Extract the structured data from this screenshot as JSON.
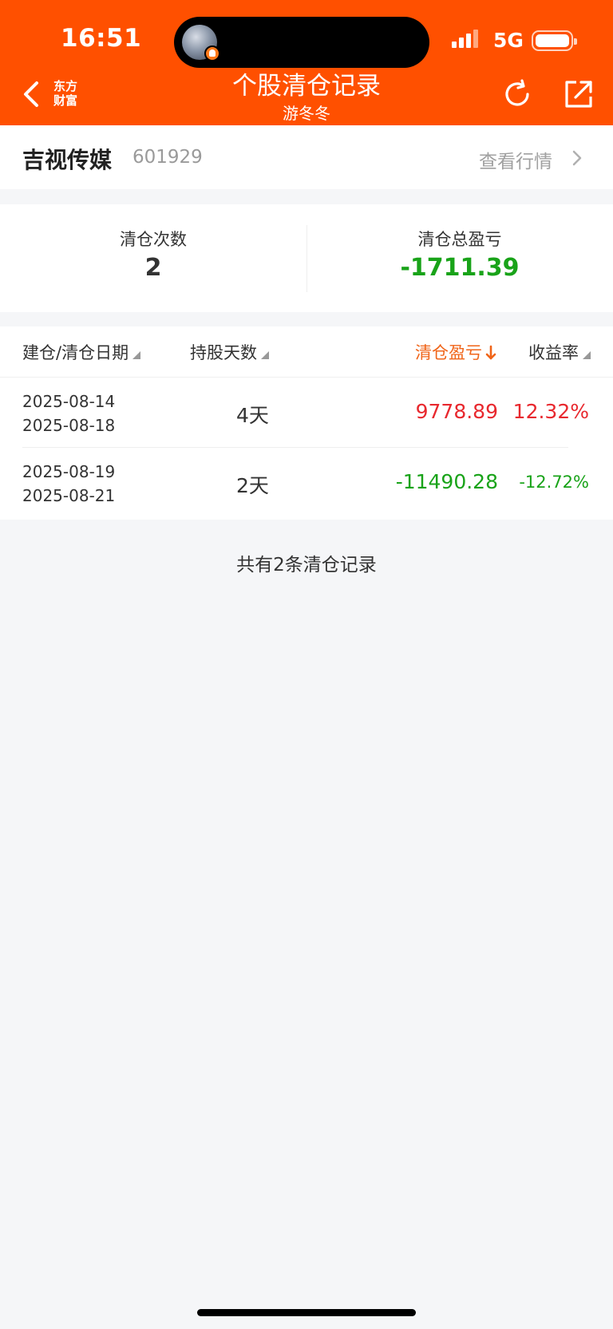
{
  "status_bar": {
    "time": "16:51",
    "network": "5G"
  },
  "header": {
    "brand_line1": "东方",
    "brand_line2": "财富",
    "title": "个股清仓记录",
    "subtitle": "游冬冬",
    "background": "#ff5000"
  },
  "stock": {
    "name": "吉视传媒",
    "code": "601929",
    "view_quote": "查看行情"
  },
  "summary": {
    "count_label": "清仓次数",
    "count_value": "2",
    "total_label": "清仓总盈亏",
    "total_value": "-1711.39"
  },
  "table": {
    "headers": {
      "date": "建仓/清仓日期",
      "hold_days": "持股天数",
      "pnl": "清仓盈亏",
      "return_rate": "收益率"
    },
    "rows": [
      {
        "open_date": "2025-08-14",
        "close_date": "2025-08-18",
        "days": "4天",
        "pnl": "9778.89",
        "rate": "12.32%"
      },
      {
        "open_date": "2025-08-19",
        "close_date": "2025-08-21",
        "days": "2天",
        "pnl": "-11490.28",
        "rate": "-12.72%"
      }
    ]
  },
  "footer_note": "共有2条清仓记录",
  "colors": {
    "gain": "#e8282e",
    "loss": "#19a319",
    "accent": "#f06418"
  }
}
